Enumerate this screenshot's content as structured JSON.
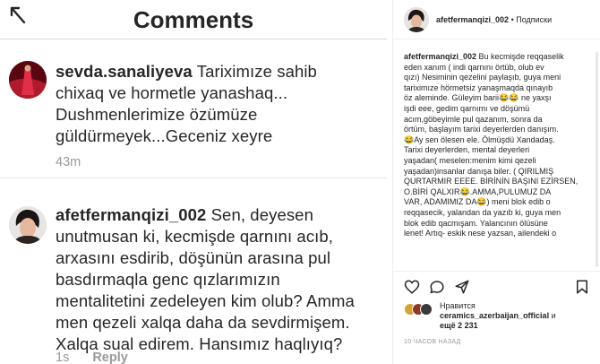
{
  "left": {
    "title": "Comments",
    "comments": [
      {
        "username": "sevda.sanaliyeva",
        "lines": [
          " Tariximıze sahib",
          "chixaq ve hormetle yanashaq...",
          "Dushmenlerimize özümüze",
          "güldürmeyek...Geceniz xeyre"
        ],
        "time": "43m"
      },
      {
        "username": "afetfermanqizi_002",
        "lines": [
          " Sen, deyesen",
          "unutmusan ki, kecmişde qarnını acıb,",
          "arxasını esdirib, döşünün arasına pul",
          "basdırmaqla genc qızlarımızın",
          "mentalitetini zedeleyen kim olub? Amma",
          "men qezeli xalqa daha da sevdirmişem.",
          "Xalqa sual edirem. Hansımız haqlıyıq?"
        ],
        "time": "1s",
        "reply": "Reply"
      }
    ]
  },
  "right": {
    "username": "afetfermanqizi_002",
    "dot": "•",
    "follow": "Подписки",
    "caption_user": "afetfermanqizi_002",
    "caption_lines": [
      " Bu kecmişde reqqaselik",
      "eden xanım ( indi qarnını örtüb, olub ev",
      "qızı) Nesiminin qezelini paylaşıb, guya meni",
      "tariximıze hörmetsiz yanaşmaqda qınayıb",
      "öz aleminde. Güleyim barii😂😂 ne yaxşı",
      "işdi eee, gedim qarnımı ve döşümü",
      "acım,göbeyimle pul qazanım, sonra da",
      "örtüm, başlayım tarixi deyerlerden danışım.",
      "😂Ay sen ölesen ele. Ölmüşdü Xandadaş.",
      "Tarixi deyerlerden, mental deyerleri",
      "yaşadan( meselen:menim kimi qezeli",
      "yaşadan)insanlar danışa biler. ( QIRILMIŞ",
      "QURTARMIR EEEE. BİRİNİN BAŞINI EZİRSEN,",
      "O.BİRİ QALXIR😂.AMMA,PULUMUZ DA",
      "VAR, ADAMIMIZ DA😂) meni blok edib o",
      "reqqasecik, yalandan da yazıb ki, guya men",
      "blok edib qacmışam. Yalancının ölüsüne",
      "lenet! Artıq- eskik nese yazsan, ailendeki o"
    ],
    "likes_prefix": "Нравится",
    "likes_user": "ceramics_azerbaijan_official",
    "likes_suffix": " и",
    "likes_more": "ещё 2 231",
    "time": "10 ЧАСОВ НАЗАД"
  }
}
